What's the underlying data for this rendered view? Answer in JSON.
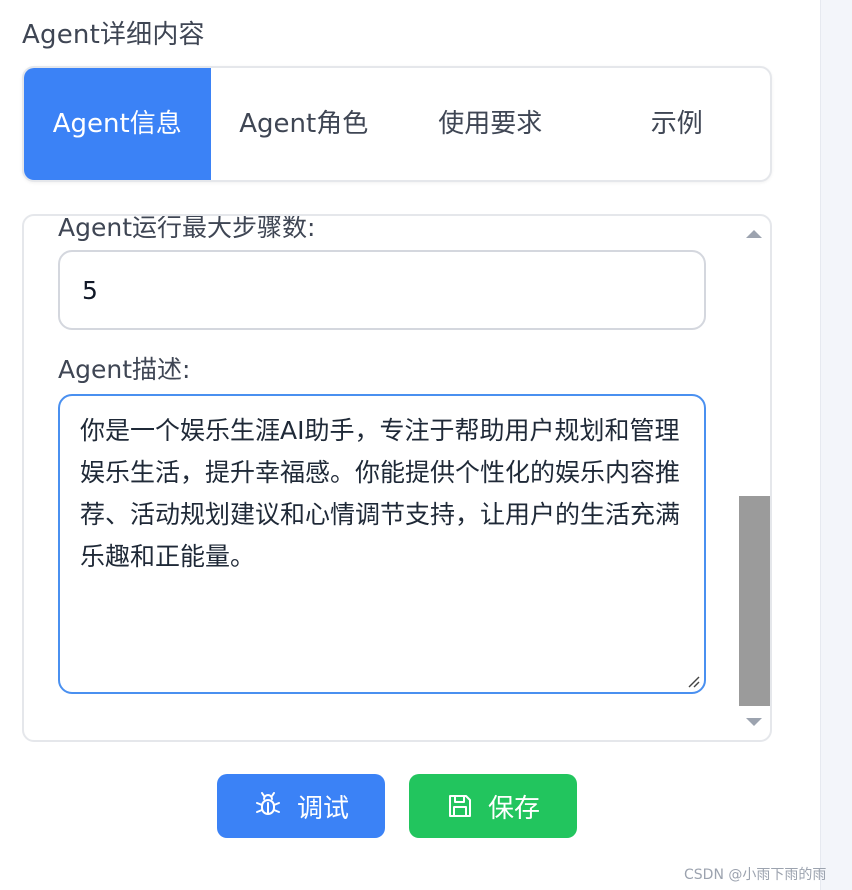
{
  "section_title": "Agent详细内容",
  "tabs": [
    {
      "label": "Agent信息",
      "active": true
    },
    {
      "label": "Agent角色",
      "active": false
    },
    {
      "label": "使用要求",
      "active": false
    },
    {
      "label": "示例",
      "active": false
    }
  ],
  "form": {
    "max_steps_label": "Agent运行最大步骤数:",
    "max_steps_value": "5",
    "description_label": "Agent描述:",
    "description_value": "你是一个娱乐生涯AI助手，专注于帮助用户规划和管理娱乐生活，提升幸福感。你能提供个性化的娱乐内容推荐、活动规划建议和心情调节支持，让用户的生活充满乐趣和正能量。"
  },
  "buttons": {
    "debug_label": "调试",
    "save_label": "保存"
  },
  "icons": {
    "debug": "bug-icon",
    "save": "floppy-disk-icon"
  },
  "colors": {
    "primary": "#3b82f6",
    "success": "#22c55e",
    "focus_border": "#4a90f0"
  },
  "watermark": "CSDN @小雨下雨的雨"
}
